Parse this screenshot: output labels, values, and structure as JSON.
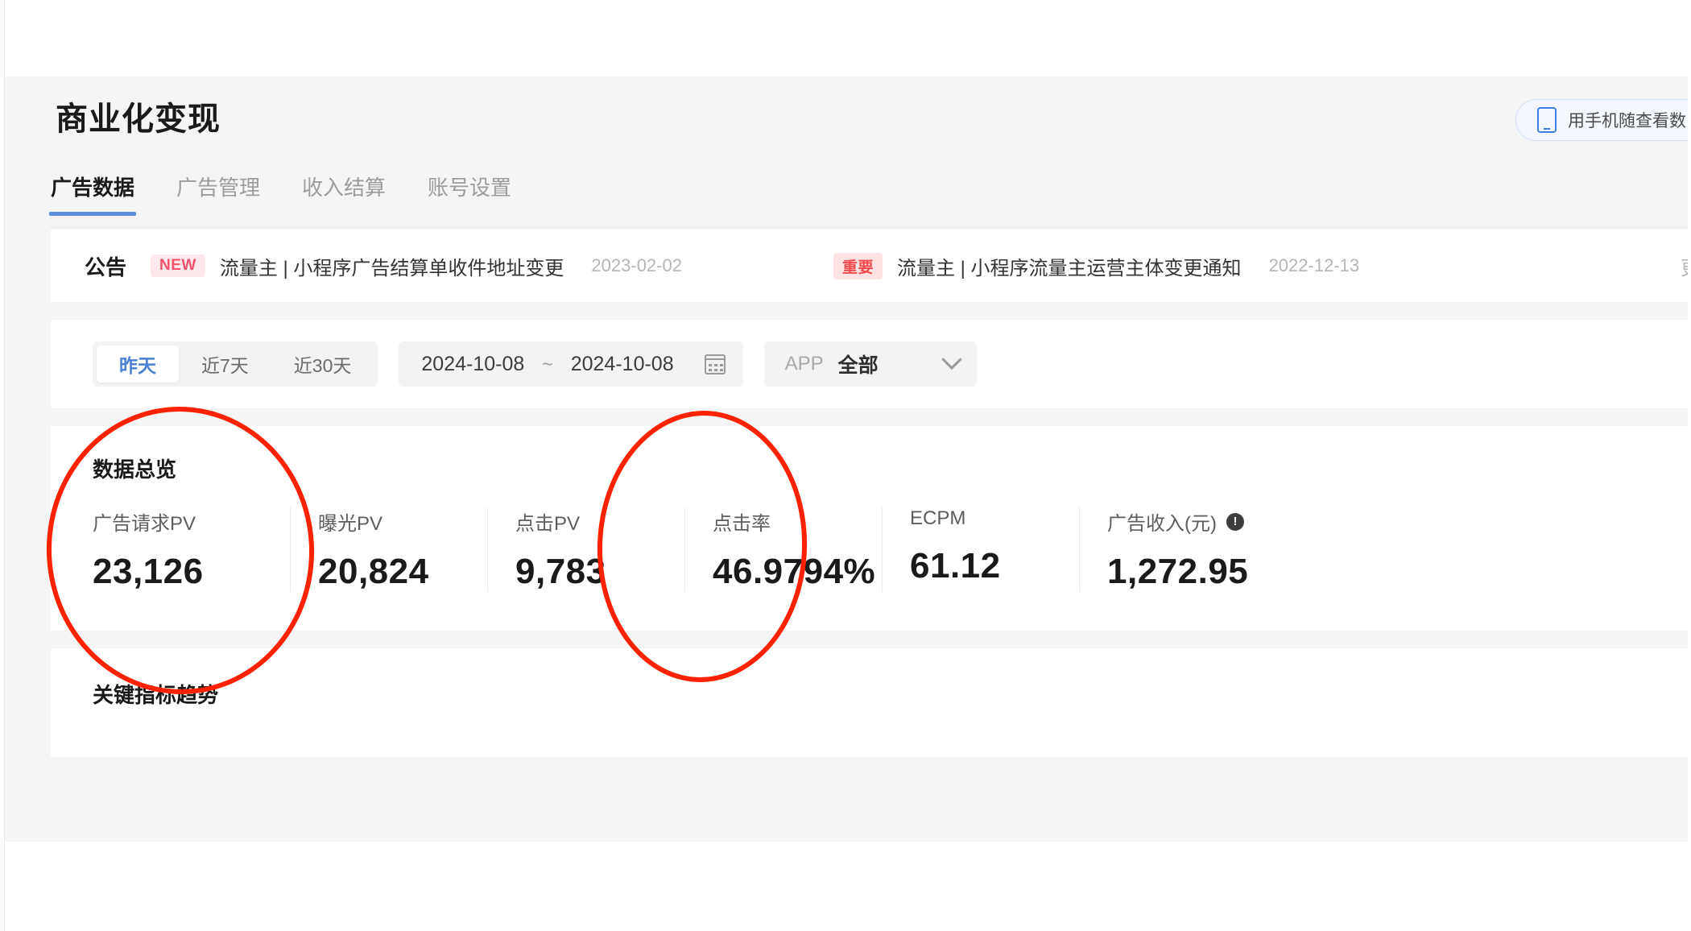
{
  "header": {
    "title": "商业化变现",
    "phone_button": {
      "label": "用手机随查看数",
      "icon": "phone-icon"
    }
  },
  "tabs": [
    {
      "label": "广告数据",
      "active": true
    },
    {
      "label": "广告管理",
      "active": false
    },
    {
      "label": "收入结算",
      "active": false
    },
    {
      "label": "账号设置",
      "active": false
    }
  ],
  "announcement": {
    "title": "公告",
    "more_label": "更多",
    "items": [
      {
        "badge": "NEW",
        "badge_type": "new",
        "text": "流量主 | 小程序广告结算单收件地址变更",
        "date": "2023-02-02"
      },
      {
        "badge": "重要",
        "badge_type": "important",
        "text": "流量主 | 小程序流量主运营主体变更通知",
        "date": "2022-12-13"
      }
    ]
  },
  "filters": {
    "range_presets": [
      {
        "label": "昨天",
        "active": true
      },
      {
        "label": "近7天",
        "active": false
      },
      {
        "label": "近30天",
        "active": false
      }
    ],
    "date_start": "2024-10-08",
    "date_separator": "~",
    "date_end": "2024-10-08",
    "calendar_icon": "calendar-icon",
    "app_filter": {
      "label": "APP",
      "value": "全部",
      "chevron": "chevron-down-icon"
    }
  },
  "overview": {
    "title": "数据总览",
    "metrics": [
      {
        "label": "广告请求PV",
        "value": "23,126",
        "info": false
      },
      {
        "label": "曝光PV",
        "value": "20,824",
        "info": false
      },
      {
        "label": "点击PV",
        "value": "9,783",
        "info": false
      },
      {
        "label": "点击率",
        "value": "46.9794%",
        "info": false
      },
      {
        "label": "ECPM",
        "value": "61.12",
        "info": false
      },
      {
        "label": "广告收入(元)",
        "value": "1,272.95",
        "info": true,
        "info_glyph": "!"
      }
    ]
  },
  "trend": {
    "title": "关键指标趋势"
  },
  "annotations": {
    "color": "#ff2200",
    "shapes": [
      {
        "name": "highlight-ad-request-pv",
        "shape": "ellipse"
      },
      {
        "name": "highlight-click-pv",
        "shape": "ellipse"
      }
    ]
  }
}
